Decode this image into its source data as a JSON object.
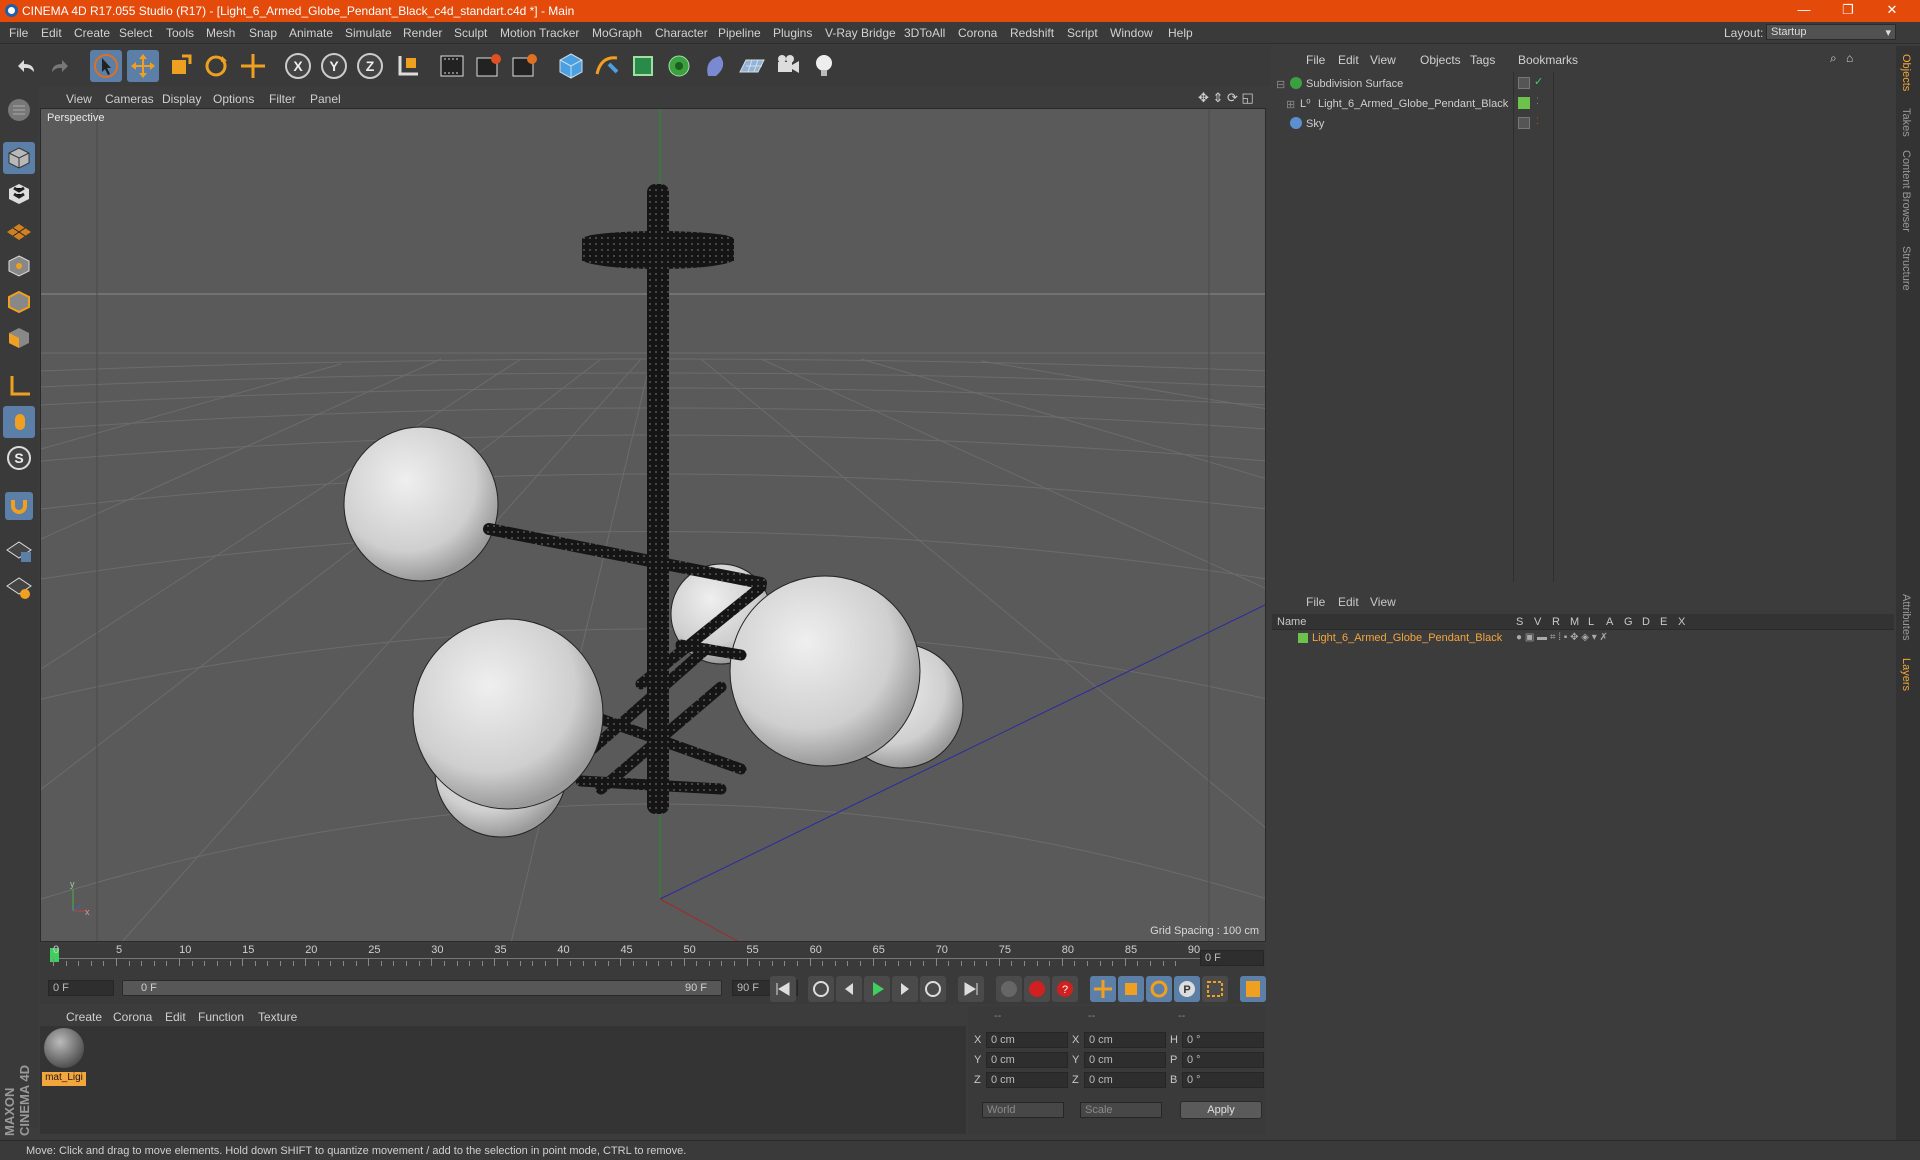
{
  "title": {
    "text": "CINEMA 4D R17.055 Studio (R17) - [Light_6_Armed_Globe_Pendant_Black_c4d_standart.c4d *] - Main",
    "minimize": "—",
    "restore": "❐",
    "close": "✕"
  },
  "menubar": {
    "items": [
      "File",
      "Edit",
      "Create",
      "Select",
      "Tools",
      "Mesh",
      "Snap",
      "Animate",
      "Simulate",
      "Render",
      "Sculpt",
      "Motion Tracker",
      "MoGraph",
      "Character",
      "Pipeline",
      "Plugins",
      "V-Ray Bridge",
      "3DToAll",
      "Corona",
      "Redshift",
      "Script",
      "Window",
      "Help"
    ],
    "layout_label": "Layout:",
    "layout_value": "Startup"
  },
  "viewport": {
    "menu": [
      "View",
      "Cameras",
      "Display",
      "Options",
      "Filter",
      "Panel"
    ],
    "camera_label": "Perspective",
    "grid_spacing": "Grid Spacing : 100 cm"
  },
  "timeline": {
    "ticks": [
      "0",
      "5",
      "10",
      "15",
      "20",
      "25",
      "30",
      "35",
      "40",
      "45",
      "50",
      "55",
      "60",
      "65",
      "70",
      "75",
      "80",
      "85",
      "90"
    ],
    "current_frame": "0 F",
    "start_field": "0 F",
    "range_start": "0 F",
    "range_end": "90 F",
    "end_field": "90 F"
  },
  "materials": {
    "menu": [
      "Create",
      "Corona",
      "Edit",
      "Function",
      "Texture"
    ],
    "items": [
      {
        "label": "mat_Ligi"
      }
    ]
  },
  "coords": {
    "headers": [
      "--",
      "--",
      "--"
    ],
    "rows": [
      {
        "a": "X",
        "av": "0 cm",
        "b": "X",
        "bv": "0 cm",
        "c": "H",
        "cv": "0 °"
      },
      {
        "a": "Y",
        "av": "0 cm",
        "b": "Y",
        "bv": "0 cm",
        "c": "P",
        "cv": "0 °"
      },
      {
        "a": "Z",
        "av": "0 cm",
        "b": "Z",
        "bv": "0 cm",
        "c": "B",
        "cv": "0 °"
      }
    ],
    "world": "World",
    "scale": "Scale",
    "apply": "Apply"
  },
  "object_manager": {
    "menu": [
      "File",
      "Edit",
      "View",
      "Objects",
      "Tags",
      "Bookmarks"
    ],
    "objects": [
      {
        "name": "Subdivision Surface"
      },
      {
        "name": "Light_6_Armed_Globe_Pendant_Black"
      },
      {
        "name": "Sky"
      }
    ]
  },
  "layer_manager": {
    "menu": [
      "File",
      "Edit",
      "View"
    ],
    "col_name": "Name",
    "cols": [
      "S",
      "V",
      "R",
      "M",
      "L",
      "A",
      "G",
      "D",
      "E",
      "X"
    ],
    "layers": [
      {
        "name": "Light_6_Armed_Globe_Pendant_Black"
      }
    ]
  },
  "side_tabs": [
    "Objects",
    "Takes",
    "Content Browser",
    "Structure",
    "Attributes",
    "Layers"
  ],
  "brand": "MAXON CINEMA 4D",
  "status": "Move: Click and drag to move elements. Hold down SHIFT to quantize movement / add to the selection in point mode, CTRL to remove.",
  "colors": {
    "title_bar": "#e44b0a",
    "accent": "#f4a63c",
    "layer_green": "#6cc24a"
  }
}
